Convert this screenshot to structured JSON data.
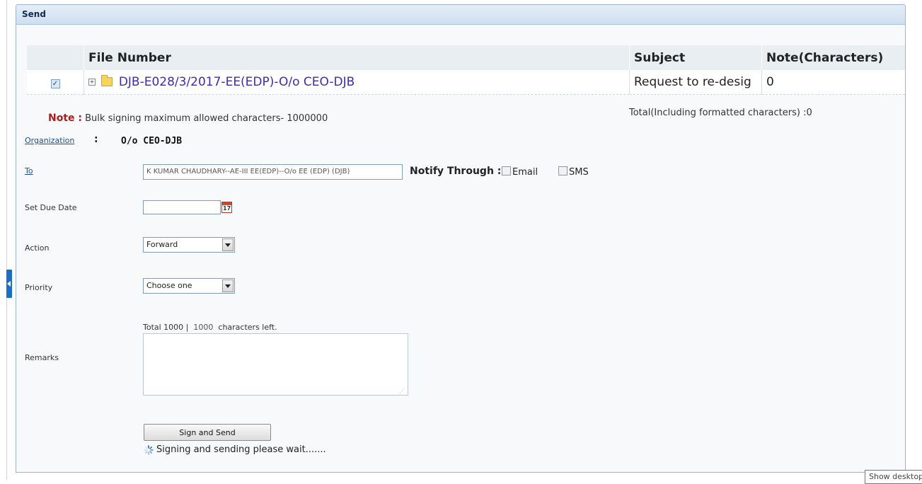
{
  "panel": {
    "title": "Send"
  },
  "files_table": {
    "headers": [
      "",
      "File Number",
      "Subject",
      "Note(Characters)"
    ],
    "rows": [
      {
        "checked": true,
        "file_number": "DJB-E028/3/2017-EE(EDP)-O/o CEO-DJB",
        "subject": "Request to re-desig",
        "note_chars": "0"
      }
    ]
  },
  "note": {
    "key": "Note :",
    "text": "Bulk signing maximum allowed characters- 1000000",
    "total": "Total(Including formatted characters) :0"
  },
  "organization": {
    "label": "Organization",
    "colon": ":",
    "value": "O/o CEO-DJB"
  },
  "to": {
    "label": "To",
    "value": "K KUMAR CHAUDHARY--AE-III EE(EDP)--O/o EE (EDP) (DJB)"
  },
  "notify": {
    "label": "Notify Through :",
    "email_label": "Email",
    "sms_label": "SMS",
    "email_checked": false,
    "sms_checked": false
  },
  "due_date": {
    "label": "Set Due Date",
    "value": "",
    "calendar_day": "17"
  },
  "action": {
    "label": "Action",
    "selected": "Forward"
  },
  "priority": {
    "label": "Priority",
    "selected": "Choose one"
  },
  "remarks": {
    "label": "Remarks",
    "counter_prefix": "Total 1000 |",
    "chars_left": "1000",
    "counter_suffix": "characters left.",
    "value": ""
  },
  "send_button": {
    "label": "Sign and Send"
  },
  "status": {
    "text": "Signing and sending please wait......."
  },
  "tooltip": {
    "text": "Show desktop"
  },
  "icons": {
    "checkbox": "checkbox-checked-icon",
    "expand": "tree-expand-icon",
    "folder": "folder-icon",
    "calendar": "calendar-icon",
    "dropdown": "chevron-down-icon",
    "spinner": "loading-spinner-icon",
    "sidebar_toggle": "collapse-arrow-icon"
  },
  "colors": {
    "link": "#3d2bb0",
    "note_key": "#b01c1c",
    "header_gradient_top": "#e5eef8",
    "header_gradient_bottom": "#cfdff0",
    "accent_toggle": "#1a6fc4"
  }
}
